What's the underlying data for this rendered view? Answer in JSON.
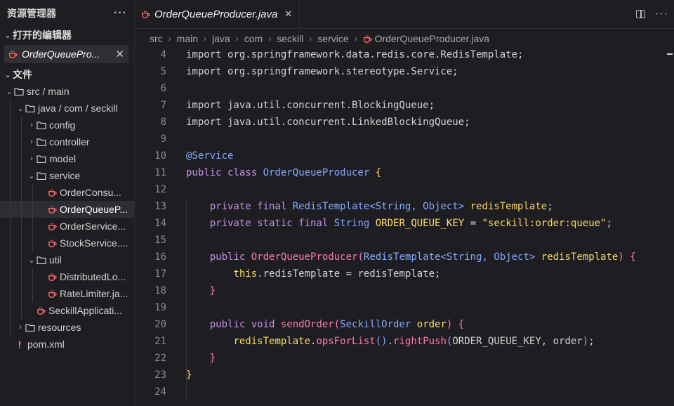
{
  "explorer": {
    "title": "资源管理器",
    "more": "···",
    "open_editors_title": "打开的编辑器",
    "open_editor_file": "OrderQueuePro...",
    "workspace_title": "文件",
    "tree": [
      {
        "label": "src / main",
        "chev": "⌄"
      },
      {
        "label": "java / com / seckill",
        "chev": "⌄"
      },
      {
        "label": "config",
        "chev": "›"
      },
      {
        "label": "controller",
        "chev": "›"
      },
      {
        "label": "model",
        "chev": "›"
      },
      {
        "label": "service",
        "chev": "⌄"
      },
      {
        "label": "OrderConsu..."
      },
      {
        "label": "OrderQueueP..."
      },
      {
        "label": "OrderService..."
      },
      {
        "label": "StockService...."
      },
      {
        "label": "util",
        "chev": "⌄"
      },
      {
        "label": "DistributedLo..."
      },
      {
        "label": "RateLimiter.ja..."
      },
      {
        "label": "SeckillApplicati..."
      },
      {
        "label": "resources",
        "chev": "›"
      },
      {
        "label": "pom.xml"
      }
    ]
  },
  "editor": {
    "tab_label": "OrderQueueProducer.java",
    "breadcrumb": [
      "src",
      "main",
      "java",
      "com",
      "seckill",
      "service",
      "OrderQueueProducer.java"
    ],
    "more": "···",
    "line_numbers": [
      "4",
      "5",
      "6",
      "7",
      "8",
      "9",
      "10",
      "11",
      "12",
      "13",
      "14",
      "15",
      "16",
      "17",
      "18",
      "19",
      "20",
      "21",
      "22",
      "23",
      "24"
    ],
    "code": {
      "l4": "import org.springframework.data.redis.core.RedisTemplate;",
      "l5": "import org.springframework.stereotype.Service;",
      "l7": "import java.util.concurrent.BlockingQueue;",
      "l8": "import java.util.concurrent.LinkedBlockingQueue;",
      "l10": "@Service",
      "l11a": "public class ",
      "l11b": "OrderQueueProducer",
      "l13a": "private final ",
      "l13b": "RedisTemplate",
      "l13c": "<String, Object>",
      "l13d": "redisTemplate",
      "l14a": "private static final ",
      "l14b": "String",
      "l14c": "ORDER_QUEUE_KEY",
      "l14d": "\"seckill:order:queue\"",
      "l16a": "public ",
      "l16b": "OrderQueueProducer",
      "l16c": "RedisTemplate",
      "l16d": "<String, Object>",
      "l16e": "redisTemplate",
      "l17a": "this",
      "l17b": ".redisTemplate = redisTemplate;",
      "l20a": "public void ",
      "l20b": "sendOrder",
      "l20c": "SeckillOrder",
      "l20d": "order",
      "l21a": "redisTemplate",
      "l21b": "opsForList",
      "l21c": "rightPush",
      "l21d": "ORDER_QUEUE_KEY, order"
    }
  },
  "colors": {
    "keyword": "#c792ea",
    "type": "#82aaff",
    "method": "#ff7ab2",
    "string": "#ffd866"
  }
}
